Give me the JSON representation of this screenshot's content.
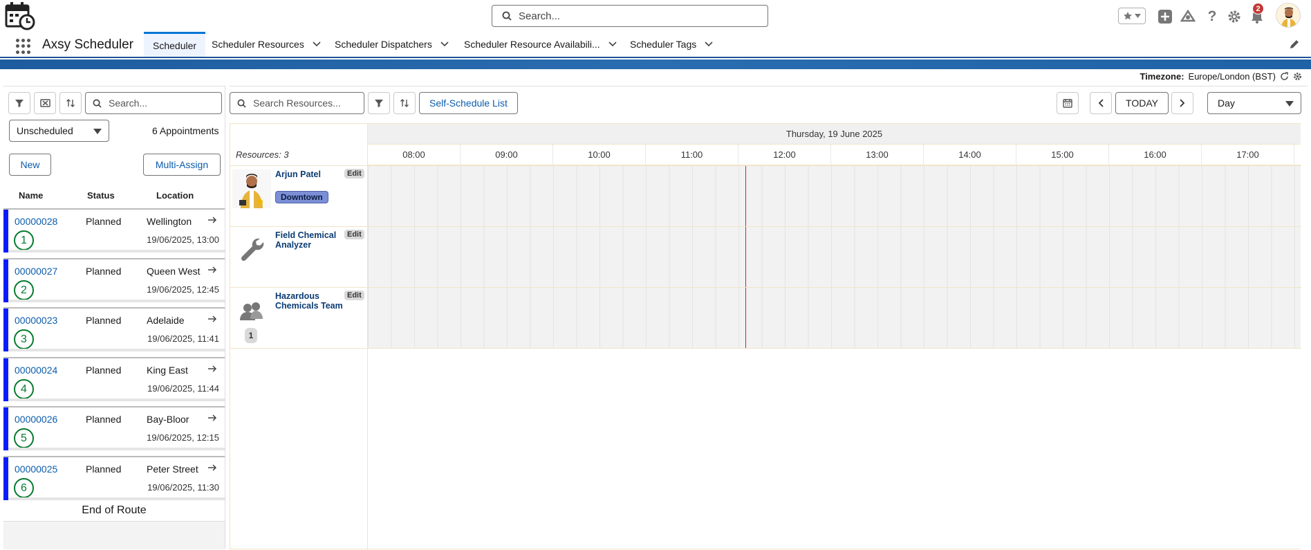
{
  "header": {
    "search_placeholder": "Search...",
    "notification_count": "2",
    "icons": [
      "app-calendar-logo",
      "search-icon",
      "favorites-star-icon",
      "add-icon",
      "setup-assistant-icon",
      "help-icon",
      "gear-icon",
      "bell-icon",
      "user-avatar"
    ]
  },
  "nav": {
    "app_name": "Axsy Scheduler",
    "tabs": [
      {
        "label": "Scheduler"
      },
      {
        "label": "Scheduler Resources"
      },
      {
        "label": "Scheduler Dispatchers"
      },
      {
        "label": "Scheduler Resource Availabili..."
      },
      {
        "label": "Scheduler Tags"
      }
    ]
  },
  "timezone": {
    "label": "Timezone:",
    "value": "Europe/London (BST)"
  },
  "left": {
    "search_placeholder": "Search...",
    "filter_value": "Unscheduled",
    "appointment_count": "6 Appointments",
    "new_label": "New",
    "multi_assign_label": "Multi-Assign",
    "columns": {
      "name": "Name",
      "status": "Status",
      "location": "Location"
    },
    "appointments": [
      {
        "number": "00000028",
        "status": "Planned",
        "location": "Wellington",
        "datetime": "19/06/2025, 13:00",
        "order": "1"
      },
      {
        "number": "00000027",
        "status": "Planned",
        "location": "Queen West",
        "datetime": "19/06/2025, 12:45",
        "order": "2"
      },
      {
        "number": "00000023",
        "status": "Planned",
        "location": "Adelaide",
        "datetime": "19/06/2025, 11:41",
        "order": "3"
      },
      {
        "number": "00000024",
        "status": "Planned",
        "location": "King East",
        "datetime": "19/06/2025, 11:44",
        "order": "4"
      },
      {
        "number": "00000026",
        "status": "Planned",
        "location": "Bay-Bloor",
        "datetime": "19/06/2025, 12:15",
        "order": "5"
      },
      {
        "number": "00000025",
        "status": "Planned",
        "location": "Peter Street",
        "datetime": "19/06/2025, 11:30",
        "order": "6"
      }
    ],
    "end_label": "End of Route",
    "accent_color": "#0a1cff",
    "order_color": "#067a2e"
  },
  "right": {
    "search_placeholder": "Search Resources...",
    "self_schedule_label": "Self-Schedule List",
    "today_label": "TODAY",
    "view_value": "Day",
    "date_label": "Thursday, 19 June 2025",
    "resources_count": "Resources: 3",
    "hours": [
      "08:00",
      "09:00",
      "10:00",
      "11:00",
      "12:00",
      "13:00",
      "14:00",
      "15:00",
      "16:00",
      "17:00"
    ],
    "resources": [
      {
        "name": "Arjun Patel",
        "edit": "Edit",
        "tag": "Downtown",
        "icon": "person-avatar"
      },
      {
        "name": "Field Chemical Analyzer",
        "edit": "Edit",
        "icon": "wrench-icon"
      },
      {
        "name": "Hazardous Chemicals Team",
        "edit": "Edit",
        "members": "1",
        "icon": "team-icon"
      }
    ],
    "now_line_color": "#d42020"
  }
}
